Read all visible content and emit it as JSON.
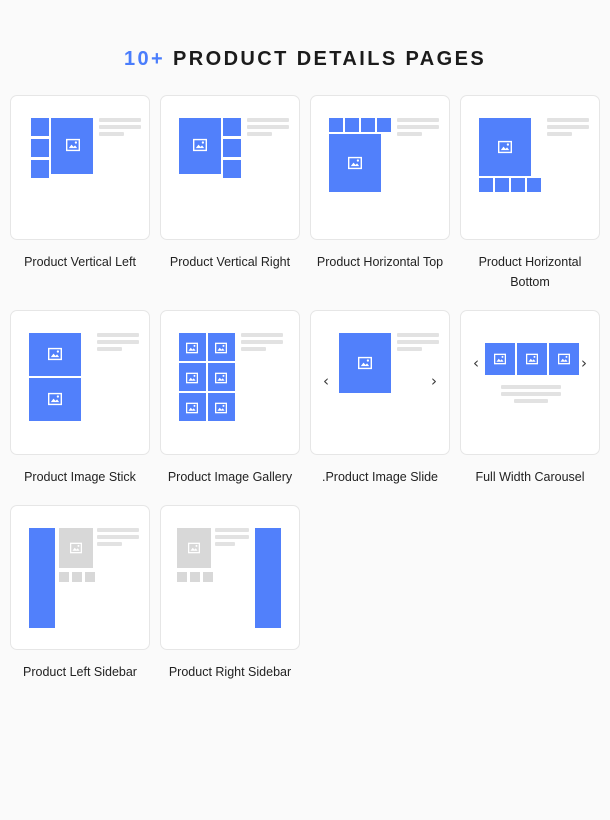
{
  "header": {
    "count_label": "10+",
    "title": "PRODUCT DETAILS PAGES",
    "accent_color": "#4a7dfc",
    "text_color": "#1b1b1b"
  },
  "theme": {
    "page_background": "#fafafa",
    "card_background": "#ffffff",
    "card_border": "#e6e6e6",
    "blue": "#5180fb",
    "gray": "#d8d8d8",
    "line_gray": "#e2e2e2",
    "caption_color": "#222222"
  },
  "cards": [
    {
      "id": "product-vertical-left",
      "label": "Product Vertical Left",
      "layout": "vertical-left",
      "icon": "image-icon"
    },
    {
      "id": "product-vertical-right",
      "label": "Product Vertical Right",
      "layout": "vertical-right",
      "icon": "image-icon"
    },
    {
      "id": "product-horizontal-top",
      "label": "Product Horizontal Top",
      "layout": "horizontal-top",
      "icon": "image-icon"
    },
    {
      "id": "product-horizontal-bottom",
      "label": "Product Horizontal Bottom",
      "layout": "horizontal-bottom",
      "icon": "image-icon"
    },
    {
      "id": "product-image-stick",
      "label": "Product Image Stick",
      "layout": "image-stick",
      "icon": "image-icon"
    },
    {
      "id": "product-image-gallery",
      "label": "Product Image Gallery",
      "layout": "image-gallery",
      "icon": "image-icon"
    },
    {
      "id": "product-image-slide",
      "label": ".Product Image Slide",
      "layout": "image-slide",
      "icon": "image-icon"
    },
    {
      "id": "full-width-carousel",
      "label": "Full Width Carousel",
      "layout": "full-width-carousel",
      "icon": "image-icon"
    },
    {
      "id": "product-left-sidebar",
      "label": "Product Left Sidebar",
      "layout": "left-sidebar",
      "icon": "image-icon"
    },
    {
      "id": "product-right-sidebar",
      "label": "Product Right Sidebar",
      "layout": "right-sidebar",
      "icon": "image-icon"
    }
  ],
  "controls": {
    "prev_arrow": "‹",
    "next_arrow": "›"
  }
}
